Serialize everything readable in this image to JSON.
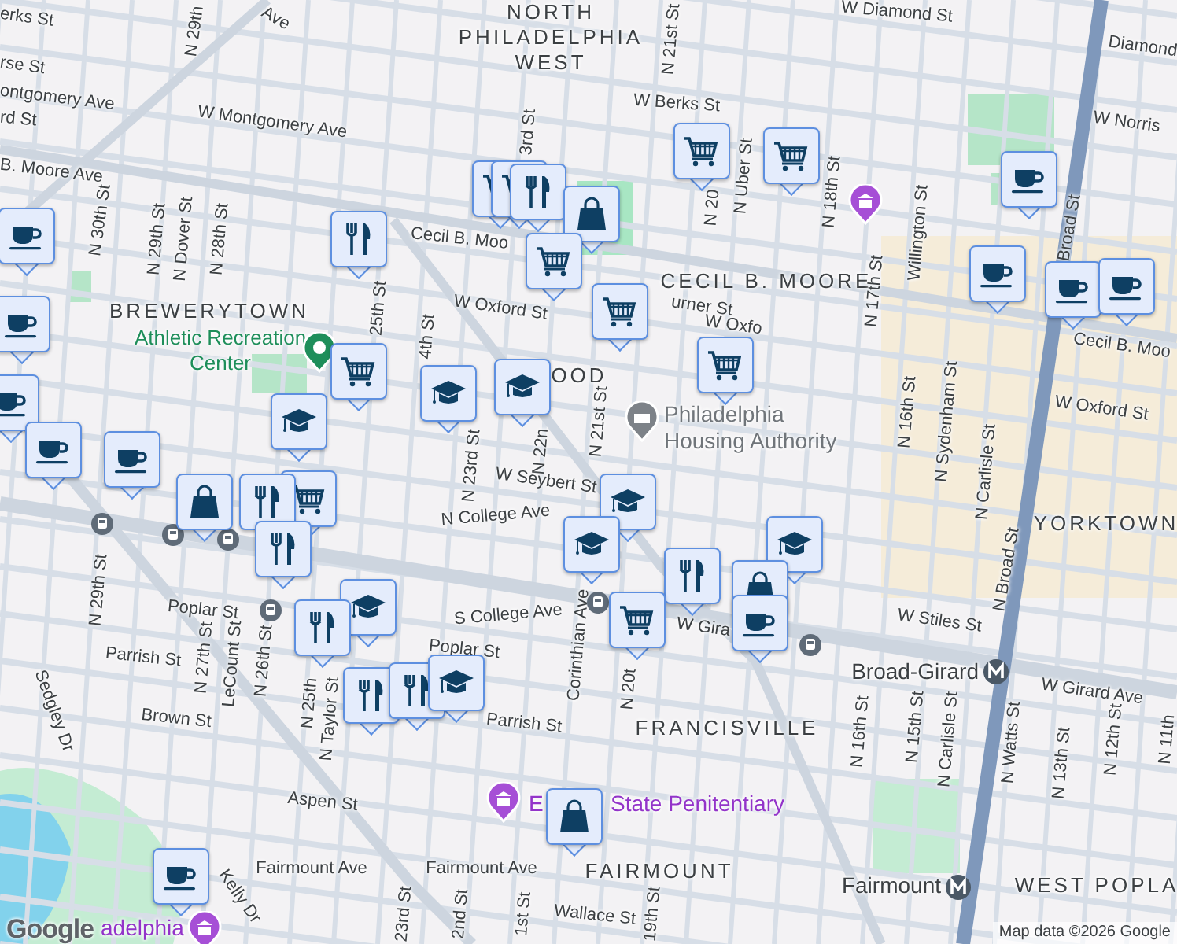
{
  "map": {
    "labels": [
      {
        "kind": "area",
        "text": "NORTH PHILADELPHIA WEST"
      },
      {
        "kind": "area",
        "text": "BREWERYTOWN"
      },
      {
        "kind": "area",
        "text": "CECIL B. MOORE"
      },
      {
        "kind": "area",
        "text": "YORKTOWN"
      },
      {
        "kind": "area",
        "text": "FRANCISVILLE"
      },
      {
        "kind": "area",
        "text": "FAIRMOUNT"
      },
      {
        "kind": "area",
        "text": "WEST POPLA"
      },
      {
        "kind": "area",
        "text": "OOD"
      },
      {
        "kind": "park",
        "text": "Athletic Recreation Center"
      },
      {
        "kind": "office",
        "text": "Philadelphia Housing Authority"
      },
      {
        "kind": "landmark",
        "text": "State Penitentiary"
      },
      {
        "kind": "landmark",
        "text": "adelphia"
      },
      {
        "kind": "station",
        "text": "Broad-Girard"
      },
      {
        "kind": "station",
        "text": "Fairmount"
      },
      {
        "kind": "street",
        "text": "erks St"
      },
      {
        "kind": "street",
        "text": "rse St"
      },
      {
        "kind": "street",
        "text": "ontgomery Ave"
      },
      {
        "kind": "street",
        "text": "rd St"
      },
      {
        "kind": "street",
        "text": "W Montgomery Ave"
      },
      {
        "kind": "street",
        "text": "B. Moore Ave"
      },
      {
        "kind": "street",
        "text": "N 30th St"
      },
      {
        "kind": "street",
        "text": "N 29th St"
      },
      {
        "kind": "street",
        "text": "N Dover St"
      },
      {
        "kind": "street",
        "text": "N 28th St"
      },
      {
        "kind": "street",
        "text": "N 29th"
      },
      {
        "kind": "street",
        "text": "Ave"
      },
      {
        "kind": "street",
        "text": "25th St"
      },
      {
        "kind": "street",
        "text": "W Berks St"
      },
      {
        "kind": "street",
        "text": "N 21st St"
      },
      {
        "kind": "street",
        "text": "3rd St"
      },
      {
        "kind": "street",
        "text": "Cecil B. Moo"
      },
      {
        "kind": "street",
        "text": "W Oxford St"
      },
      {
        "kind": "street",
        "text": "urner St"
      },
      {
        "kind": "street",
        "text": "W Oxfo"
      },
      {
        "kind": "street",
        "text": "4th St"
      },
      {
        "kind": "street",
        "text": "N 20"
      },
      {
        "kind": "street",
        "text": "N Uber St"
      },
      {
        "kind": "street",
        "text": "N 18th St"
      },
      {
        "kind": "street",
        "text": "N 17th St"
      },
      {
        "kind": "street",
        "text": "Willington St"
      },
      {
        "kind": "street",
        "text": "N 16th St"
      },
      {
        "kind": "street",
        "text": "N Sydenham St"
      },
      {
        "kind": "street",
        "text": "Broad St"
      },
      {
        "kind": "street",
        "text": "Diamond"
      },
      {
        "kind": "street",
        "text": "W Diamond St"
      },
      {
        "kind": "street",
        "text": "W Norris"
      },
      {
        "kind": "street",
        "text": "Cecil B. Moo"
      },
      {
        "kind": "street",
        "text": "W Oxford St"
      },
      {
        "kind": "street",
        "text": "N Carlisle St"
      },
      {
        "kind": "street",
        "text": "N 22n"
      },
      {
        "kind": "street",
        "text": "N 21st St"
      },
      {
        "kind": "street",
        "text": "W Seybert St"
      },
      {
        "kind": "street",
        "text": "N College Ave"
      },
      {
        "kind": "street",
        "text": "S College Ave"
      },
      {
        "kind": "street",
        "text": "Corinthian Ave"
      },
      {
        "kind": "street",
        "text": "N 20t"
      },
      {
        "kind": "street",
        "text": "W Gira"
      },
      {
        "kind": "street",
        "text": "W Stiles St"
      },
      {
        "kind": "street",
        "text": "W Girard Ave"
      },
      {
        "kind": "street",
        "text": "N Broad St"
      },
      {
        "kind": "street",
        "text": "N 16th St"
      },
      {
        "kind": "street",
        "text": "N 15th St"
      },
      {
        "kind": "street",
        "text": "N Carlisle St"
      },
      {
        "kind": "street",
        "text": "N Watts St"
      },
      {
        "kind": "street",
        "text": "N 13th St"
      },
      {
        "kind": "street",
        "text": "N 12th St"
      },
      {
        "kind": "street",
        "text": "N 11th"
      },
      {
        "kind": "street",
        "text": "Poplar St"
      },
      {
        "kind": "street",
        "text": "Poplar St"
      },
      {
        "kind": "street",
        "text": "Parrish St"
      },
      {
        "kind": "street",
        "text": "Parrish St"
      },
      {
        "kind": "street",
        "text": "N 29th St"
      },
      {
        "kind": "street",
        "text": "N 27th St"
      },
      {
        "kind": "street",
        "text": "LeCount St"
      },
      {
        "kind": "street",
        "text": "N 26th St"
      },
      {
        "kind": "street",
        "text": "N 25th"
      },
      {
        "kind": "street",
        "text": "N Taylor St"
      },
      {
        "kind": "street",
        "text": "Brown St"
      },
      {
        "kind": "street",
        "text": "Sedgley Dr"
      },
      {
        "kind": "street",
        "text": "Aspen St"
      },
      {
        "kind": "street",
        "text": "Fairmount Ave"
      },
      {
        "kind": "street",
        "text": "Fairmount Ave"
      },
      {
        "kind": "street",
        "text": "Kelly Dr"
      },
      {
        "kind": "street",
        "text": "N 23rd St"
      },
      {
        "kind": "street",
        "text": "23rd St"
      },
      {
        "kind": "street",
        "text": "2nd St"
      },
      {
        "kind": "street",
        "text": "1st St"
      },
      {
        "kind": "street",
        "text": "19th St"
      },
      {
        "kind": "street",
        "text": "Wallace St"
      },
      {
        "kind": "landmark",
        "text": "E"
      }
    ],
    "pois": [
      {
        "kind": "park"
      },
      {
        "kind": "office"
      },
      {
        "kind": "landmark"
      },
      {
        "kind": "landmark"
      },
      {
        "kind": "landmark"
      },
      {
        "kind": "tram"
      },
      {
        "kind": "tram"
      },
      {
        "kind": "tram"
      },
      {
        "kind": "tram"
      },
      {
        "kind": "tram"
      },
      {
        "kind": "tram"
      },
      {
        "kind": "metro"
      },
      {
        "kind": "metro"
      }
    ],
    "markers": [
      {
        "kind": "cup"
      },
      {
        "kind": "cup"
      },
      {
        "kind": "cup"
      },
      {
        "kind": "cup"
      },
      {
        "kind": "cup"
      },
      {
        "kind": "food"
      },
      {
        "kind": "cart"
      },
      {
        "kind": "school"
      },
      {
        "kind": "school"
      },
      {
        "kind": "school"
      },
      {
        "kind": "cart"
      },
      {
        "kind": "cart"
      },
      {
        "kind": "food"
      },
      {
        "kind": "bag"
      },
      {
        "kind": "cart"
      },
      {
        "kind": "cart"
      },
      {
        "kind": "cart"
      },
      {
        "kind": "cart"
      },
      {
        "kind": "cart"
      },
      {
        "kind": "bag"
      },
      {
        "kind": "cart"
      },
      {
        "kind": "food"
      },
      {
        "kind": "food"
      },
      {
        "kind": "school"
      },
      {
        "kind": "school"
      },
      {
        "kind": "food"
      },
      {
        "kind": "cart"
      },
      {
        "kind": "school"
      },
      {
        "kind": "bag"
      },
      {
        "kind": "cup"
      },
      {
        "kind": "school"
      },
      {
        "kind": "food"
      },
      {
        "kind": "food"
      },
      {
        "kind": "food"
      },
      {
        "kind": "school"
      },
      {
        "kind": "cup"
      },
      {
        "kind": "cup"
      },
      {
        "kind": "cup"
      },
      {
        "kind": "cup"
      },
      {
        "kind": "bag"
      },
      {
        "kind": "cup"
      }
    ],
    "attribution": {
      "logo": "Google",
      "text": "Map data ©2026 Google"
    }
  }
}
